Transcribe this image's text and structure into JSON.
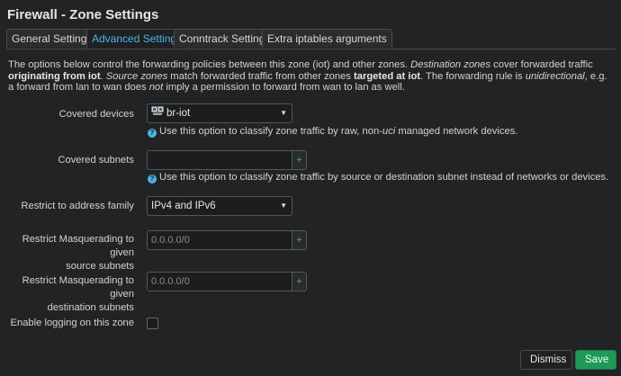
{
  "title": "Firewall - Zone Settings",
  "tabs": [
    {
      "label": "General Settings"
    },
    {
      "label": "Advanced Settings"
    },
    {
      "label": "Conntrack Settings"
    },
    {
      "label": "Extra iptables arguments"
    }
  ],
  "active_tab": "Advanced Settings",
  "description": {
    "p1": "The options below control the forwarding policies between this zone (iot) and other zones. ",
    "p2_i": "Destination zones",
    "p3": " cover forwarded traffic ",
    "p4_b": "originating from iot",
    "p5": ". ",
    "p6_i": "Source zones",
    "p7": " match forwarded traffic from other zones ",
    "p8_b": "targeted at iot",
    "p9": ". The forwarding rule is ",
    "p10_i": "unidirectional",
    "p11": ", e.g. a forward from lan to wan does ",
    "p12_i": "not",
    "p13": " imply a permission to forward from wan to lan as well."
  },
  "fields": {
    "covered_devices": {
      "label": "Covered devices",
      "value": "br-iot",
      "hint_pre": "Use this option to classify zone traffic by raw, non-",
      "hint_i": "uci",
      "hint_post": " managed network devices."
    },
    "covered_subnets": {
      "label": "Covered subnets",
      "value": "",
      "placeholder": "",
      "hint": "Use this option to classify zone traffic by source or destination subnet instead of networks or devices."
    },
    "address_family": {
      "label": "Restrict to address family",
      "value": "IPv4 and IPv6"
    },
    "masq_src": {
      "label_line1": "Restrict Masquerading to given",
      "label_line2": "source subnets",
      "placeholder": "0.0.0.0/0"
    },
    "masq_dest": {
      "label_line1": "Restrict Masquerading to given",
      "label_line2": "destination subnets",
      "placeholder": "0.0.0.0/0"
    },
    "logging": {
      "label": "Enable logging on this zone",
      "checked": false
    }
  },
  "buttons": {
    "dismiss": "Dismiss",
    "save": "Save",
    "plus": "+"
  },
  "icons": {
    "help": "?",
    "caret": "▼",
    "device": "network-device-icon"
  },
  "colors": {
    "accent": "#4fb3e8",
    "save": "#1f9957",
    "plus": "#3cb878",
    "background": "#222324"
  }
}
